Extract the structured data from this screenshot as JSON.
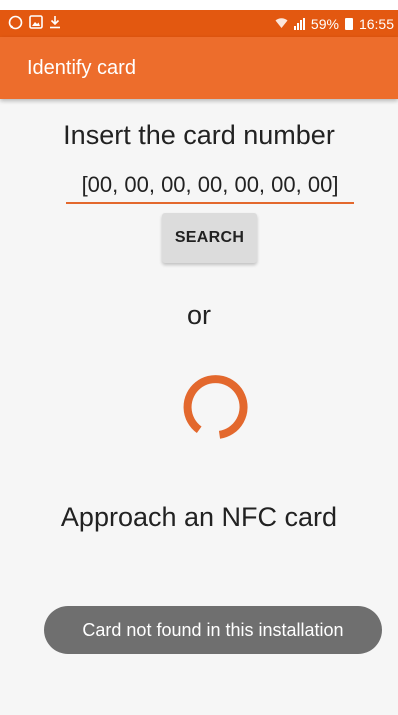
{
  "status_bar": {
    "left_icons": [
      "whatsapp-icon",
      "gallery-icon",
      "download-icon"
    ],
    "battery": "59%",
    "time": "16:55"
  },
  "app_bar": {
    "title": "Identify card"
  },
  "main": {
    "prompt": "Insert the card number",
    "card_input": {
      "value": "[00, 00, 00, 00, 00, 00, 00]"
    },
    "search_button": "SEARCH",
    "or_text": "or",
    "nfc_prompt": "Approach an NFC card"
  },
  "toast": {
    "message": "Card not found in this installation"
  },
  "colors": {
    "status_bar": "#e35810",
    "app_bar": "#ed6d2c",
    "accent": "#e3682d",
    "background": "#f6f6f6",
    "toast": "#6f6f6f"
  }
}
